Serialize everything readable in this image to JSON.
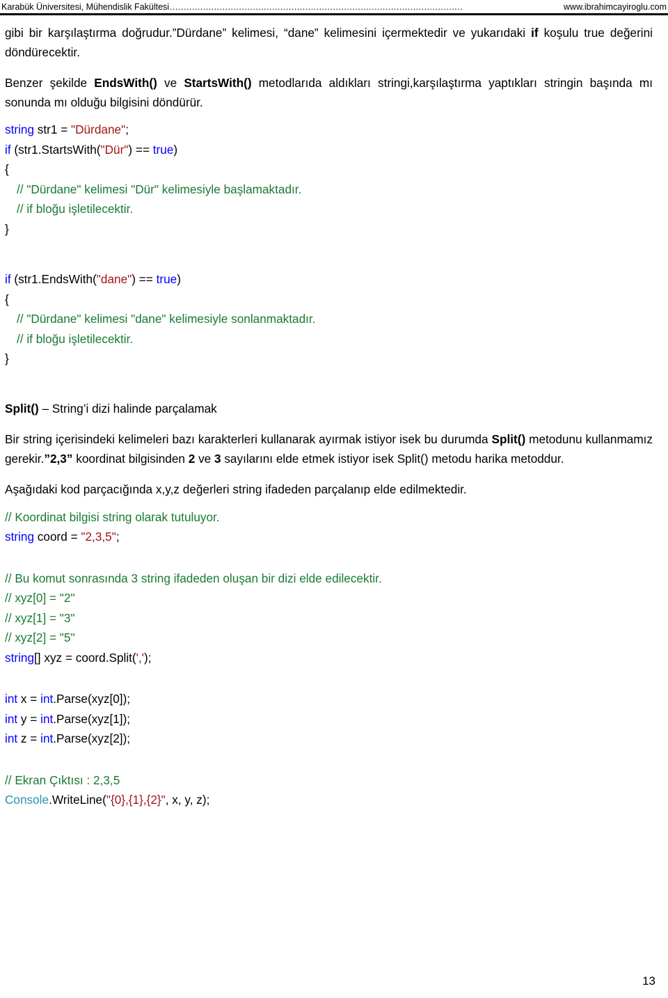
{
  "header": {
    "left": "Karabük Üniversitesi, Mühendislik Fakültesi",
    "dots": "..........................................................................................................",
    "right": "www.ibrahimcayiroglu.com"
  },
  "paragraphs": {
    "p1_a": "gibi bir karşılaştırma doğrudur.”Dürdane” kelimesi, “dane” kelimesini içermektedir ve yukarıdaki ",
    "p1_b": "if",
    "p1_c": " koşulu true değerini döndürecektir.",
    "p2_a": "Benzer şekilde ",
    "p2_b": "EndsWith()",
    "p2_c": " ve ",
    "p2_d": "StartsWith()",
    "p2_e": " metodlarıda aldıkları stringi,karşılaştırma yaptıkları stringin başında mı sonunda mı olduğu bilgisini döndürür.",
    "split_heading_a": "Split()",
    "split_heading_b": " – String’i dizi halinde parçalamak",
    "p3_a": "Bir string içerisindeki kelimeleri bazı karakterleri kullanarak ayırmak istiyor isek bu durumda ",
    "p3_b": "Split()",
    "p3_c": " metodunu kullanmamız gerekir.",
    "p3_d": "”2,3”",
    "p3_e": " koordinat bilgisinden ",
    "p3_f": "2",
    "p3_g": " ve ",
    "p3_h": "3",
    "p3_i": " sayılarını elde etmek istiyor isek Split() metodu harika metoddur.",
    "p4": "Aşağıdaki kod parçacığında x,y,z değerleri string ifadeden parçalanıp elde edilmektedir."
  },
  "code_block_1": {
    "l1_kw": "string",
    "l1_mid": " str1 = ",
    "l1_str": "\"Dürdane\"",
    "l1_end": ";",
    "l2_kw": "if",
    "l2_mid": " (str1.StartsWith(",
    "l2_str": "\"Dür\"",
    "l2_mid2": ") == ",
    "l2_kw2": "true",
    "l2_end": ")",
    "l3": "{",
    "l4": "// \"Dürdane\" kelimesi \"Dür\" kelimesiyle başlamaktadır.",
    "l5": "// if bloğu işletilecektir.",
    "l6": "}"
  },
  "code_block_2": {
    "l1_kw": "if",
    "l1_mid": " (str1.EndsWith(",
    "l1_str": "\"dane\"",
    "l1_mid2": ") == ",
    "l1_kw2": "true",
    "l1_end": ")",
    "l2": "{",
    "l3": "// \"Dürdane\" kelimesi \"dane\" kelimesiyle sonlanmaktadır.",
    "l4": "// if bloğu işletilecektir.",
    "l5": "}"
  },
  "code_block_3": {
    "c1": "// Koordinat bilgisi string olarak tutuluyor.",
    "l1_kw": "string",
    "l1_mid": " coord = ",
    "l1_str": "\"2,3,5\"",
    "l1_end": ";"
  },
  "code_block_4": {
    "c1": "// Bu komut sonrasında 3 string ifadeden oluşan bir dizi elde edilecektir.",
    "c2": "// xyz[0] = \"2\"",
    "c3": "// xyz[1] = \"3\"",
    "c4": "// xyz[2] = \"5\"",
    "l1_kw": "string",
    "l1_mid": "[] xyz = coord.Split(",
    "l1_str": "','",
    "l1_end": ");"
  },
  "code_block_5": {
    "l1_kw": "int",
    "l1_mid": " x = ",
    "l1_kw2": "int",
    "l1_end": ".Parse(xyz[0]);",
    "l2_kw": "int",
    "l2_mid": " y = ",
    "l2_kw2": "int",
    "l2_end": ".Parse(xyz[1]);",
    "l3_kw": "int",
    "l3_mid": " z = ",
    "l3_kw2": "int",
    "l3_end": ".Parse(xyz[2]);"
  },
  "code_block_6": {
    "c1": "// Ekran Çıktısı : 2,3,5",
    "l1_cls": "Console",
    "l1_mid": ".WriteLine(",
    "l1_str": "\"{0},{1},{2}\"",
    "l1_end": ", x, y, z);"
  },
  "footer": {
    "page_number": "13"
  },
  "colors": {
    "keyword": "#0000ff",
    "string": "#a31515",
    "comment": "#1a7a32",
    "class": "#2b91af",
    "text": "#000000",
    "rule": "#000000"
  }
}
